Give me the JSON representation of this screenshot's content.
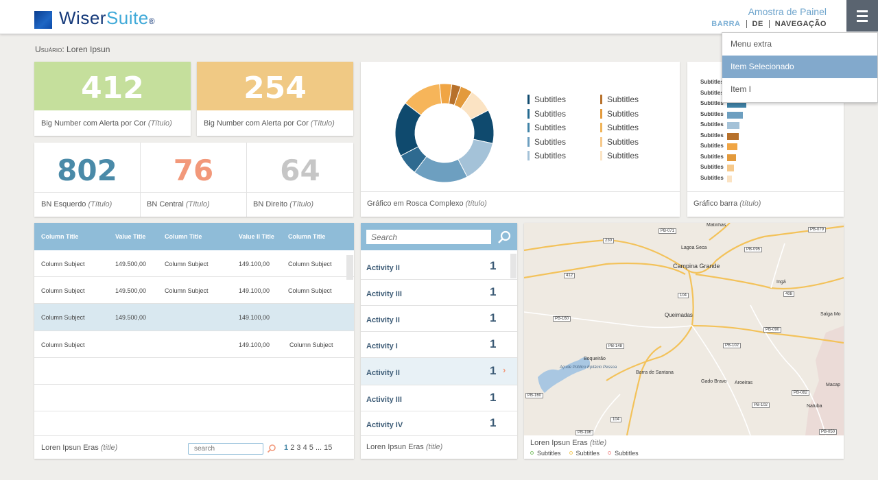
{
  "header": {
    "brand_a": "Wiser",
    "brand_b": "Suite",
    "brand_reg": "®",
    "panel_name": "Amostra de Painel",
    "nav": [
      "BARRA",
      "DE",
      "NAVEGAÇÃO"
    ]
  },
  "dropdown": {
    "items": [
      "Menu extra",
      "Item Selecionado",
      "Item I"
    ]
  },
  "user": {
    "label": "Usuário:",
    "name": "Loren Ipsun"
  },
  "big_numbers": [
    {
      "value": "412",
      "title": "Big Number com Alerta por Cor",
      "title_em": "(Título)",
      "color": "#c5df9c"
    },
    {
      "value": "254",
      "title": "Big Number com Alerta por Cor",
      "title_em": "(Título)",
      "color": "#f0c984"
    }
  ],
  "bn_panel": [
    {
      "value": "802",
      "title": "BN Esquerdo",
      "title_em": "(Título)",
      "color": "#4a8aa8"
    },
    {
      "value": "76",
      "title": "BN Central",
      "title_em": "(Título)",
      "color": "#f2987a"
    },
    {
      "value": "64",
      "title": "BN Direito",
      "title_em": "(Título)",
      "color": "#c6c6c6"
    }
  ],
  "donut": {
    "title": "Gráfico em Rosca  Complexo",
    "title_em": "(título)",
    "legend": [
      {
        "label": "Subtitles",
        "color": "#0f4a6e"
      },
      {
        "label": "Subtitles",
        "color": "#246a90"
      },
      {
        "label": "Subtitles",
        "color": "#3f82a6"
      },
      {
        "label": "Subtitles",
        "color": "#6d9fc0"
      },
      {
        "label": "Subtitles",
        "color": "#a4c2d8"
      },
      {
        "label": "Subtitles",
        "color": "#b7712b"
      },
      {
        "label": "Subtitles",
        "color": "#e39a3c"
      },
      {
        "label": "Subtitles",
        "color": "#f0b458"
      },
      {
        "label": "Subtitles",
        "color": "#f6c98b"
      },
      {
        "label": "Subtitles",
        "color": "#fbe3c3"
      }
    ]
  },
  "chart_data": {
    "type": "pie",
    "title": "",
    "values": [
      0.03,
      0.04,
      0.08,
      0.11,
      0.14,
      0.18,
      0.07,
      0.18,
      0.13,
      0.04
    ],
    "colors": [
      "#b7712b",
      "#e39a3c",
      "#fbe3c3",
      "#0f4a6e",
      "#a4c2d8",
      "#6d9fc0",
      "#2e6a90",
      "#0f4a6e",
      "#f6b55a",
      "#f0a544"
    ]
  },
  "bar_chart": {
    "title": "Gráfico barra",
    "title_em": "(título)",
    "labels": [
      "Subtitles",
      "Subtitles",
      "Subtitles",
      "Subtitles",
      "Subtitles",
      "Subtitles",
      "Subtitles",
      "Subtitles",
      "Subtitles",
      "Subtitles"
    ],
    "values": [
      0.3,
      0.5,
      0.85,
      0.7,
      0.55,
      0.5,
      0.45,
      0.4,
      0.3,
      0.2
    ],
    "colors": [
      "#0f4a6e",
      "#246a90",
      "#3f82a6",
      "#6d9fc0",
      "#a4c2d8",
      "#b7712b",
      "#f0a544",
      "#e39a3c",
      "#f6c98b",
      "#fbe3c3"
    ]
  },
  "table": {
    "headers": [
      "Column Title",
      "Value Title",
      "Column Title",
      "Value II Title",
      "Column Title"
    ],
    "rows": [
      [
        "Column Subject",
        "149.500,00",
        "Column Subject",
        "149.100,00",
        "Column Subject"
      ],
      [
        "Column Subject",
        "149.500,00",
        "Column Subject",
        "149.100,00",
        "Column Subject"
      ],
      [
        "Column Subject",
        "149.500,00",
        "",
        "149.100,00",
        ""
      ],
      [
        "Column Subject",
        "",
        "",
        "149.100,00",
        "Column Subject"
      ]
    ],
    "footer_title": "Loren Ipsun Eras",
    "footer_em": "(title)",
    "search_placeholder": "search",
    "pages": [
      "1",
      "2",
      "3",
      "4",
      "5",
      "...",
      "15"
    ]
  },
  "activity": {
    "search_placeholder": "Search",
    "rows": [
      {
        "name": "Activity II",
        "value": "1"
      },
      {
        "name": "Activity III",
        "value": "1"
      },
      {
        "name": "Activity II",
        "value": "1"
      },
      {
        "name": "Activity I",
        "value": "1"
      },
      {
        "name": "Activity II",
        "value": "1"
      },
      {
        "name": "Activity III",
        "value": "1"
      },
      {
        "name": "Activity IV",
        "value": "1"
      }
    ],
    "footer_title": "Loren Ipsun Eras",
    "footer_em": "(title)"
  },
  "map": {
    "footer_title": "Loren Ipsun Eras",
    "footer_em": "(title)",
    "legend": [
      {
        "label": "Subtitles",
        "color": "#7ec26a"
      },
      {
        "label": "Subtitles",
        "color": "#f3cc63"
      },
      {
        "label": "Subtitles",
        "color": "#f29a9a"
      }
    ],
    "places": [
      "Matinhas",
      "Lagoa Seca",
      "Campina Grande",
      "Ingá",
      "Queimadas",
      "Salga Mo",
      "Boqueirão",
      "Açude Público Epitácio Pessoa",
      "Barra de Santana",
      "Gado Bravo",
      "Aroeiras",
      "Macap",
      "Natuba"
    ],
    "road_shields": [
      "PB-079",
      "230",
      "PB-095",
      "412",
      "408",
      "104",
      "PB-160",
      "PB-090",
      "PB-148",
      "PB-102",
      "PB-160",
      "104",
      "PB-082",
      "PB-102",
      "PB-196",
      "PB-050",
      "PB-071"
    ]
  }
}
